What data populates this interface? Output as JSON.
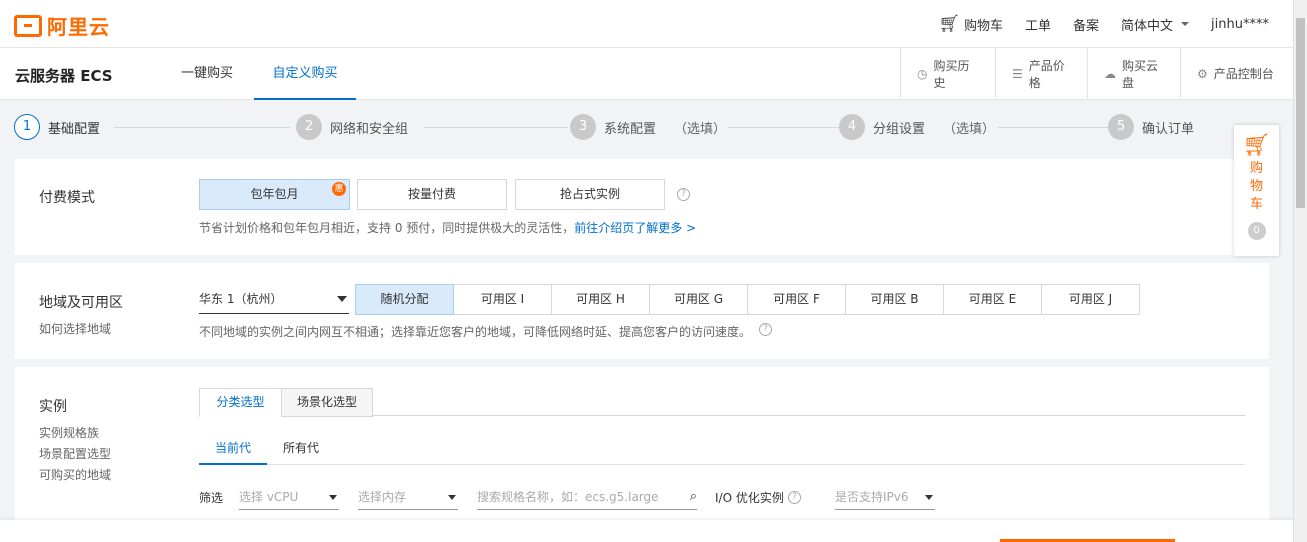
{
  "brand": {
    "logo_text": "阿里云"
  },
  "topnav": {
    "cart": "购物车",
    "ticket": "工单",
    "record": "备案",
    "language": "简体中文",
    "user": "jinhu****"
  },
  "product": {
    "title": "云服务器 ECS",
    "tabs": [
      {
        "label": "一键购买"
      },
      {
        "label": "自定义购买"
      }
    ],
    "links": [
      {
        "label": "购买历史",
        "icon": "clock-icon"
      },
      {
        "label": "产品价格",
        "icon": "list-icon"
      },
      {
        "label": "购买云盘",
        "icon": "cloud-icon"
      },
      {
        "label": "产品控制台",
        "icon": "gear-icon"
      }
    ]
  },
  "steps": [
    {
      "num": "1",
      "label": "基础配置",
      "optional": ""
    },
    {
      "num": "2",
      "label": "网络和安全组",
      "optional": ""
    },
    {
      "num": "3",
      "label": "系统配置",
      "optional": "（选填）"
    },
    {
      "num": "4",
      "label": "分组设置",
      "optional": "（选填）"
    },
    {
      "num": "5",
      "label": "确认订单",
      "optional": ""
    }
  ],
  "billing": {
    "label": "付费模式",
    "options": [
      {
        "label": "包年包月"
      },
      {
        "label": "按量付费"
      },
      {
        "label": "抢占式实例"
      }
    ],
    "discount_badge": "惠",
    "hint": "节省计划价格和包年包月相近，支持 0 预付，同时提供极大的灵活性，",
    "hint_link": "前往介绍页了解更多 >"
  },
  "region": {
    "label": "地域及可用区",
    "sublabel": "如何选择地域",
    "selected": "华东 1（杭州）",
    "zones": [
      "随机分配",
      "可用区 I",
      "可用区 H",
      "可用区 G",
      "可用区 F",
      "可用区 B",
      "可用区 E",
      "可用区 J"
    ],
    "hint": "不同地域的实例之间内网互不相通；选择靠近您客户的地域，可降低网络时延、提高您客户的访问速度。"
  },
  "instance": {
    "label": "实例",
    "sublinks": [
      "实例规格族",
      "场景配置选型",
      "可购买的地域"
    ],
    "tabs": [
      "分类选型",
      "场景化选型"
    ],
    "gen_tabs": [
      "当前代",
      "所有代"
    ],
    "filter_label": "筛选",
    "vcpu_placeholder": "选择 vCPU",
    "memory_placeholder": "选择内存",
    "search_placeholder": "搜索规格名称，如：ecs.g5.large",
    "io_label": "I/O 优化实例",
    "ipv6_placeholder": "是否支持IPv6"
  },
  "float_cart": {
    "label": "购物车",
    "count": "0"
  },
  "colors": {
    "brand": "#ff6a00",
    "accent": "#0070cc",
    "selected_bg": "#d9ebfa"
  }
}
